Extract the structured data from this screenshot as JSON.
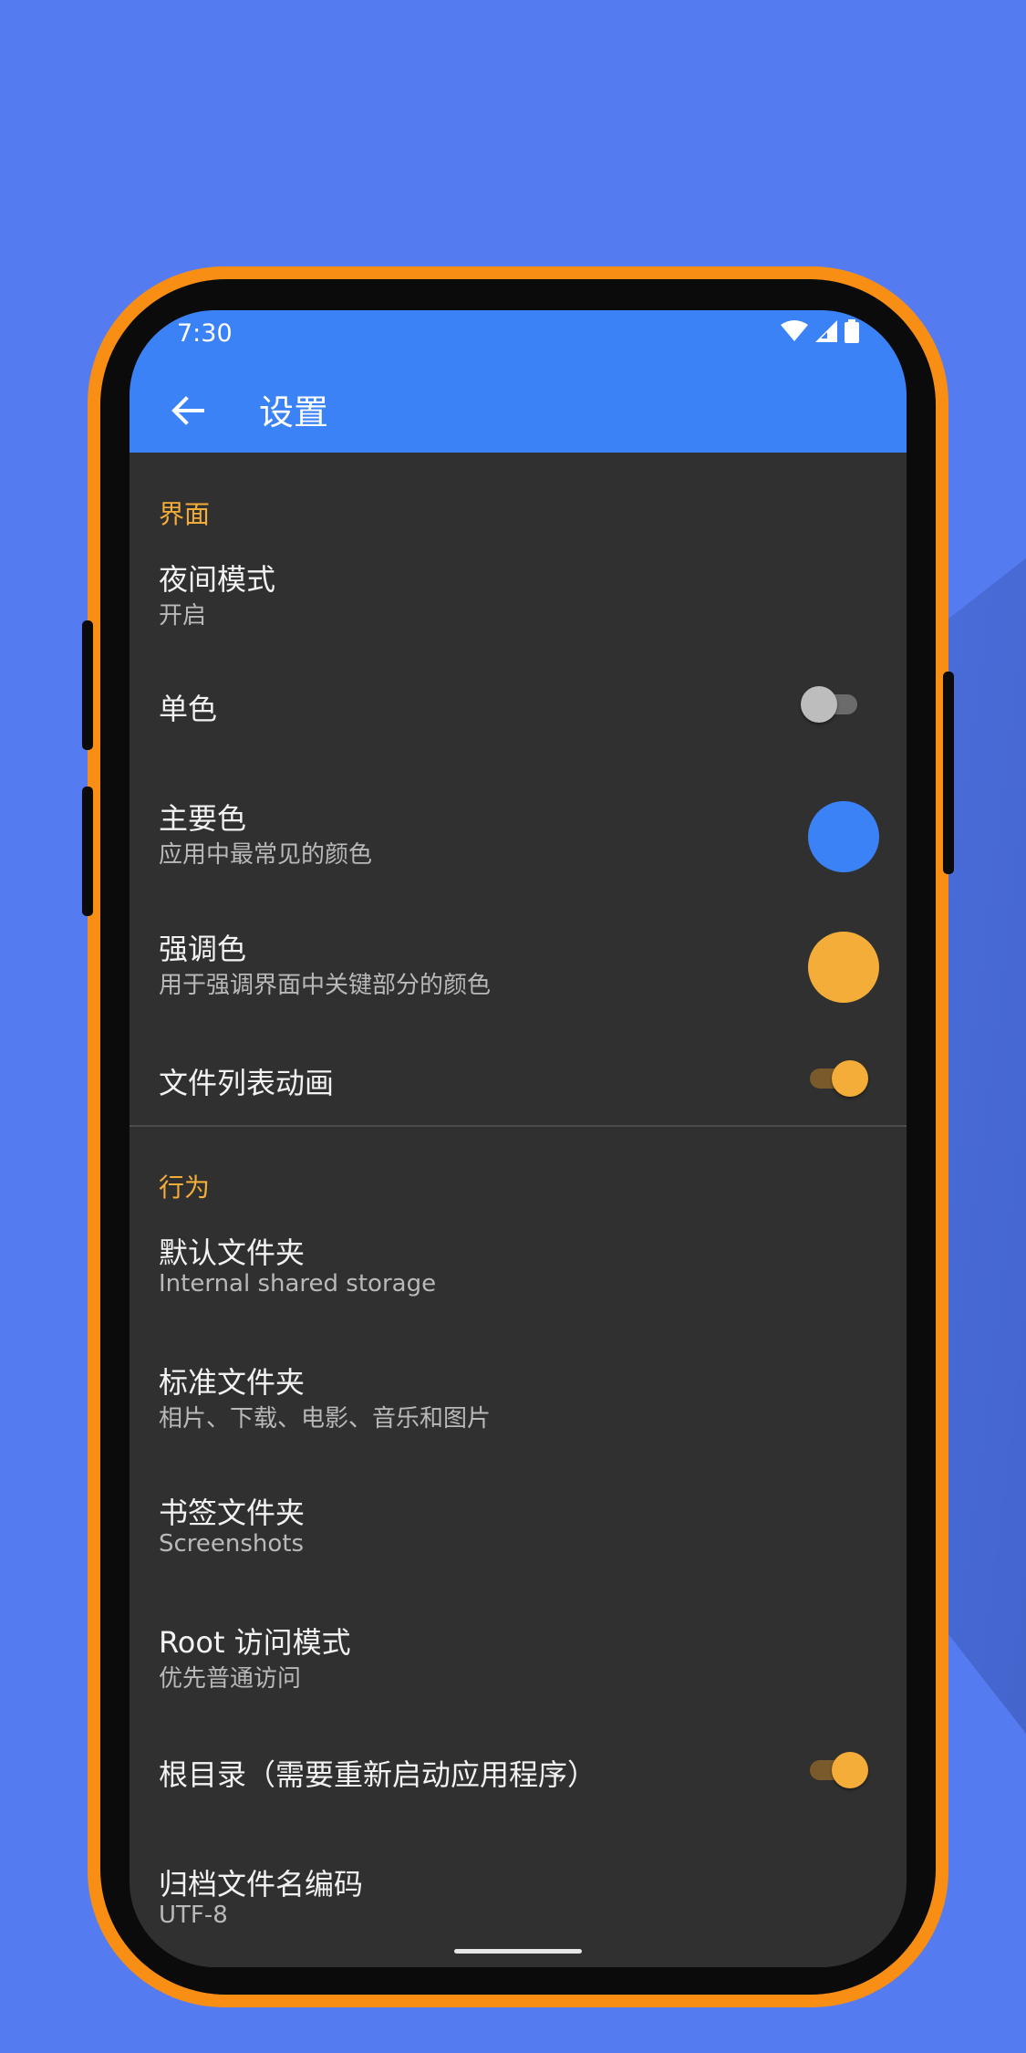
{
  "status_bar": {
    "time": "7:30",
    "wifi_icon": "wifi-icon",
    "signal_icon": "signal-icon",
    "battery_icon": "battery-icon"
  },
  "app_bar": {
    "title": "设置",
    "back_icon": "arrow-back-icon",
    "color": "#3b82f6"
  },
  "sections": {
    "interface": {
      "header": "界面",
      "night_mode": {
        "title": "夜间模式",
        "summary": "开启"
      },
      "monochrome": {
        "title": "单色",
        "enabled": false
      },
      "primary_color": {
        "title": "主要色",
        "summary": "应用中最常见的颜色",
        "color": "#3b82f6"
      },
      "accent_color": {
        "title": "强调色",
        "summary": "用于强调界面中关键部分的颜色",
        "color": "#f5ad3a"
      },
      "file_list_animation": {
        "title": "文件列表动画",
        "enabled": true
      }
    },
    "behavior": {
      "header": "行为",
      "default_folder": {
        "title": "默认文件夹",
        "summary": "Internal shared storage"
      },
      "standard_folders": {
        "title": "标准文件夹",
        "summary": "相片、下载、电影、音乐和图片"
      },
      "bookmark_folders": {
        "title": "书签文件夹",
        "summary": "Screenshots"
      },
      "root_access": {
        "title": "Root 访问模式",
        "summary": "优先普通访问"
      },
      "root_directory": {
        "title": "根目录（需要重新启动应用程序）",
        "enabled": true
      },
      "archive_encoding": {
        "title": "归档文件名编码",
        "summary": "UTF-8"
      }
    }
  },
  "colors": {
    "accent": "#f5ad3a",
    "phone_frame": "#f98e15",
    "background": "#547bf0"
  }
}
